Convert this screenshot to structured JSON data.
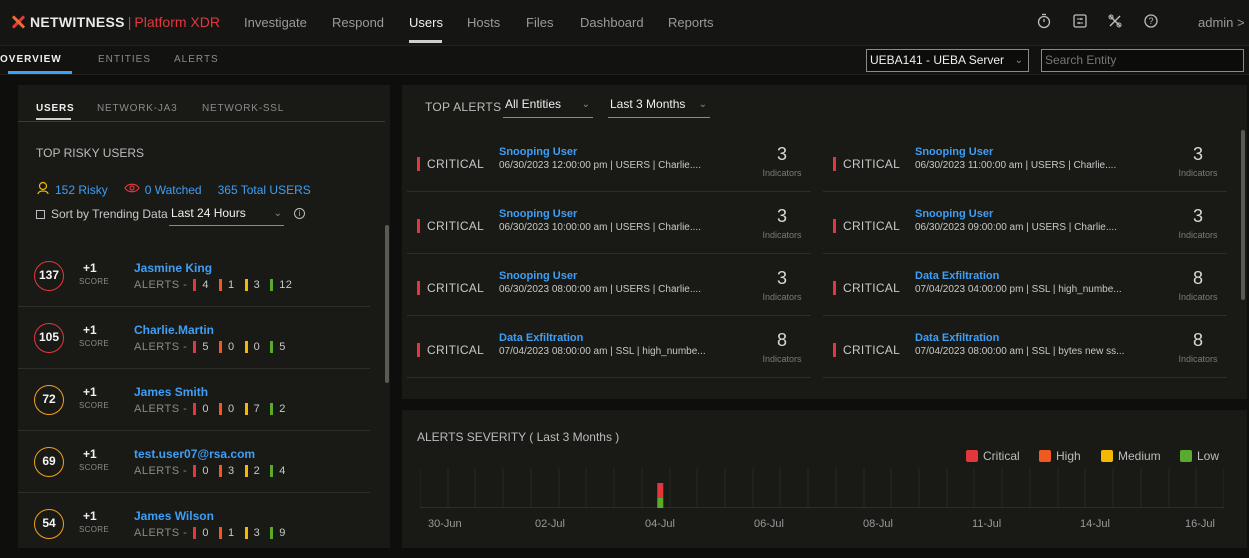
{
  "brand": {
    "name": "NETWITNESS",
    "product": "Platform XDR",
    "separator": "|"
  },
  "nav": [
    "Investigate",
    "Respond",
    "Users",
    "Hosts",
    "Files",
    "Dashboard",
    "Reports"
  ],
  "user": {
    "name": "admin",
    "chevron": ">"
  },
  "subtabs": [
    "OVERVIEW",
    "ENTITIES",
    "ALERTS"
  ],
  "server_select": {
    "value": "UEBA141 - UEBA Server",
    "chevron": "⌄"
  },
  "search": {
    "placeholder": "Search Entity"
  },
  "left": {
    "tabs": [
      "USERS",
      "NETWORK-JA3",
      "NETWORK-SSL"
    ],
    "section_title": "TOP RISKY USERS",
    "risky": "152 Risky",
    "watched": "0 Watched",
    "total": "365 Total USERS",
    "trend_label": "Sort by Trending Data",
    "trend_value": "Last 24 Hours",
    "info": "i",
    "score_label": "SCORE",
    "alerts_label": "ALERTS  -",
    "users": [
      {
        "score": "137",
        "delta": "+1",
        "name": "Jasmine King",
        "c": "4",
        "h": "1",
        "m": "3",
        "l": "12"
      },
      {
        "score": "105",
        "delta": "+1",
        "name": "Charlie.Martin",
        "c": "5",
        "h": "0",
        "m": "0",
        "l": "5"
      },
      {
        "score": "72",
        "delta": "+1",
        "name": "James Smith",
        "c": "0",
        "h": "0",
        "m": "7",
        "l": "2"
      },
      {
        "score": "69",
        "delta": "+1",
        "name": "test.user07@rsa.com",
        "c": "0",
        "h": "3",
        "m": "2",
        "l": "4"
      },
      {
        "score": "54",
        "delta": "+1",
        "name": "James Wilson",
        "c": "0",
        "h": "1",
        "m": "3",
        "l": "9"
      }
    ]
  },
  "top_alerts": {
    "title": "TOP ALERTS",
    "entity_filter": "All Entities",
    "time_filter": "Last 3 Months",
    "chevron": "⌄",
    "indicators_label": "Indicators",
    "alerts": [
      {
        "severity": "CRITICAL",
        "name": "Snooping User",
        "meta": "06/30/2023 12:00:00 pm  |  USERS  |  Charlie....",
        "count": "3"
      },
      {
        "severity": "CRITICAL",
        "name": "Snooping User",
        "meta": "06/30/2023 11:00:00 am  |  USERS  |  Charlie....",
        "count": "3"
      },
      {
        "severity": "CRITICAL",
        "name": "Snooping User",
        "meta": "06/30/2023 10:00:00 am  |  USERS  |  Charlie....",
        "count": "3"
      },
      {
        "severity": "CRITICAL",
        "name": "Snooping User",
        "meta": "06/30/2023 09:00:00 am  |  USERS  |  Charlie....",
        "count": "3"
      },
      {
        "severity": "CRITICAL",
        "name": "Snooping User",
        "meta": "06/30/2023 08:00:00 am  |  USERS  |  Charlie....",
        "count": "3"
      },
      {
        "severity": "CRITICAL",
        "name": "Data Exfiltration",
        "meta": "07/04/2023 04:00:00 pm  |  SSL  |  high_numbe...",
        "count": "8"
      },
      {
        "severity": "CRITICAL",
        "name": "Data Exfiltration",
        "meta": "07/04/2023 08:00:00 am  |  SSL  |  high_numbe...",
        "count": "8"
      },
      {
        "severity": "CRITICAL",
        "name": "Data Exfiltration",
        "meta": "07/04/2023 08:00:00 am  |  SSL  |  bytes new ss...",
        "count": "8"
      }
    ]
  },
  "severity_chart": {
    "title": "ALERTS SEVERITY ( Last 3 Months )",
    "legend": [
      "Critical",
      "High",
      "Medium",
      "Low"
    ],
    "x_labels": [
      "30-Jun",
      "02-Jul",
      "04-Jul",
      "06-Jul",
      "08-Jul",
      "11-Jul",
      "14-Jul",
      "16-Jul"
    ]
  },
  "chart_data": {
    "type": "bar",
    "title": "ALERTS SEVERITY ( Last 3 Months )",
    "categories": [
      "04-Jul"
    ],
    "series": [
      {
        "name": "Critical",
        "values": [
          3
        ]
      },
      {
        "name": "High",
        "values": [
          0
        ]
      },
      {
        "name": "Medium",
        "values": [
          0
        ]
      },
      {
        "name": "Low",
        "values": [
          2
        ]
      }
    ],
    "stacked": true,
    "ylim": [
      0,
      8
    ],
    "grid": true,
    "legend": "top-right",
    "x_ticks": [
      "30-Jun",
      "02-Jul",
      "04-Jul",
      "06-Jul",
      "08-Jul",
      "11-Jul",
      "14-Jul",
      "16-Jul"
    ]
  },
  "colors": {
    "critical": "#e3373e",
    "high": "#f05a22",
    "medium": "#f5b800",
    "low": "#5aaa2d",
    "accent": "#3f9ef5"
  },
  "icons": [
    "stopwatch-icon",
    "settings-sliders-icon",
    "tools-icon",
    "help-icon",
    "watched-eye-icon",
    "risky-users-icon",
    "info-icon"
  ]
}
